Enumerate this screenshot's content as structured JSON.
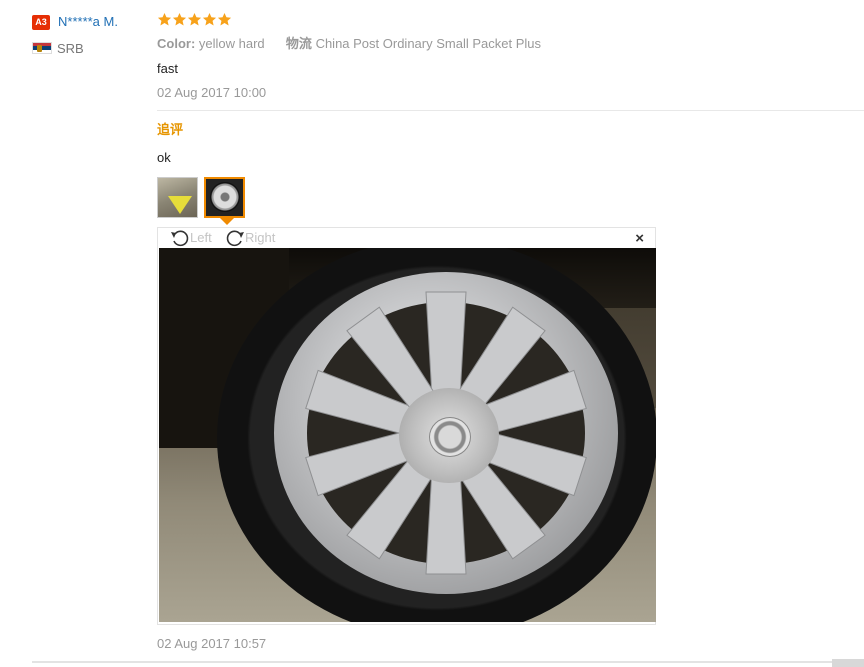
{
  "user": {
    "level_badge": "A3",
    "name": "N*****a M.",
    "country": "SRB",
    "flag_colors": [
      "#c6363c",
      "#0c4076",
      "#ffffff"
    ]
  },
  "review": {
    "rating": 5,
    "star_color": "#f7a21b",
    "attributes": [
      {
        "key": "Color:",
        "value": "yellow hard"
      },
      {
        "key": "物流",
        "value": "China Post Ordinary Small Packet Plus"
      }
    ],
    "feedback": "fast",
    "date": "02 Aug 2017 10:00"
  },
  "additional": {
    "label": "追评",
    "label_color": "#e69500",
    "text": "ok",
    "images": [
      {
        "icon": "photo-thumbnail",
        "selected": false
      },
      {
        "icon": "wheel-photo-thumbnail",
        "selected": true
      }
    ],
    "viewer": {
      "rotate_left": "Left",
      "rotate_right": "Right",
      "close": "×"
    },
    "date": "02 Aug 2017 10:57"
  }
}
